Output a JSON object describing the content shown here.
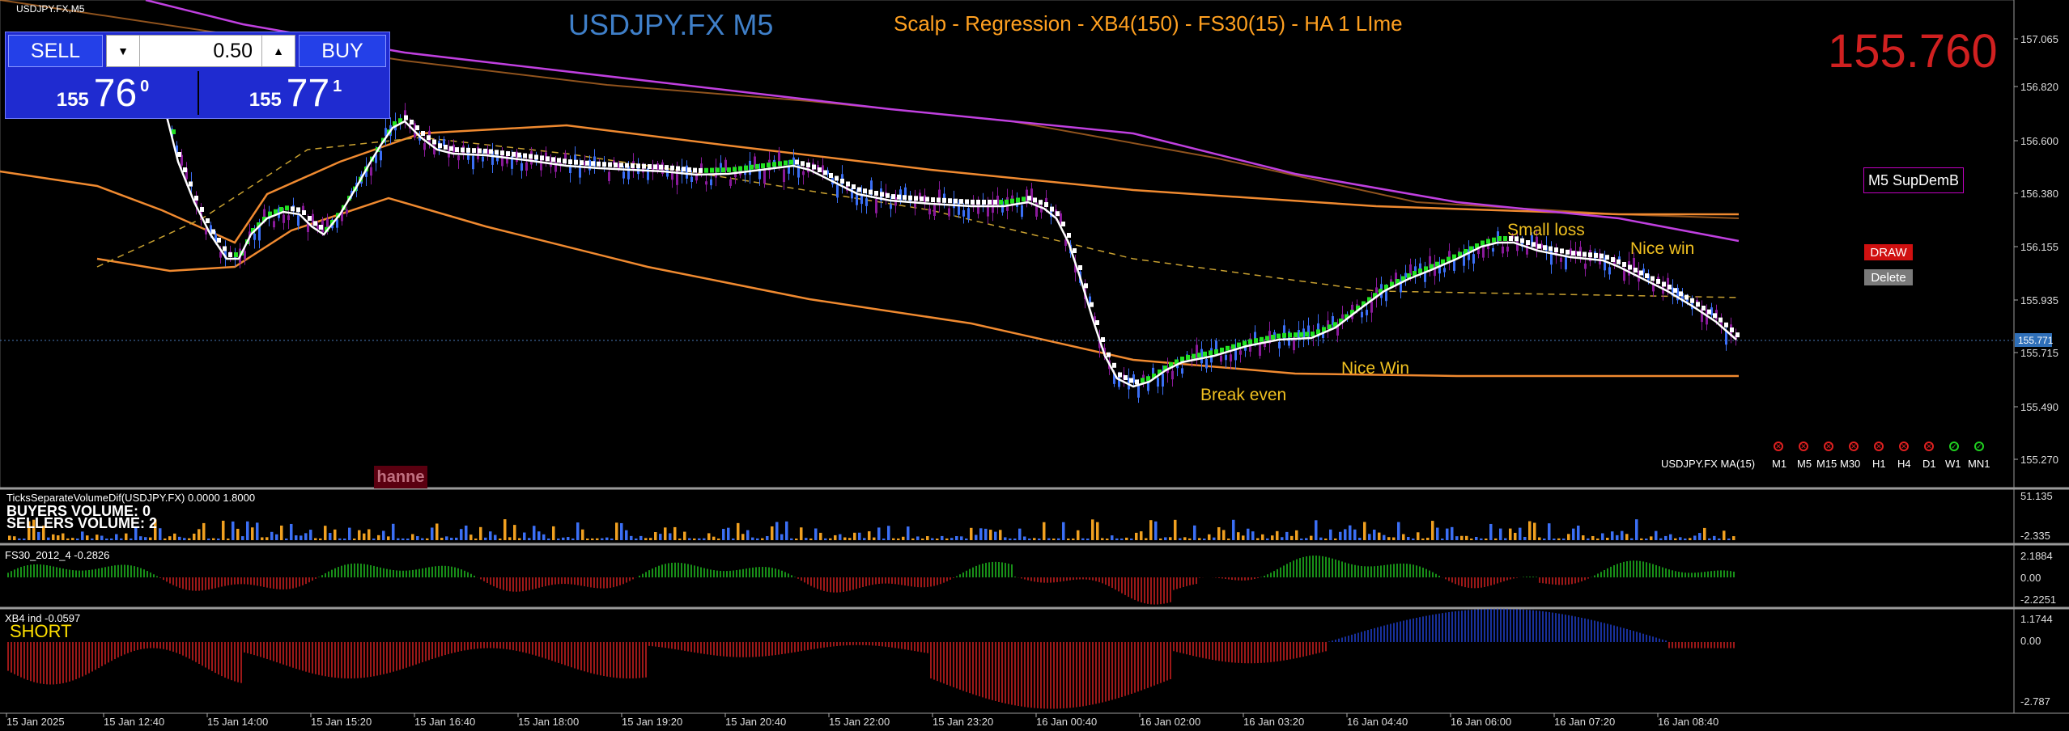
{
  "window": {
    "symbol_label": "USDJPY.FX,M5"
  },
  "header": {
    "title": "USDJPY.FX M5",
    "strategy": "Scalp - Regression - XB4(150) - FS30(15) - HA  1 LIme",
    "big_price": "155.760"
  },
  "trade_panel": {
    "sell_label": "SELL",
    "buy_label": "BUY",
    "lot_value": "0.50",
    "sell_quote": {
      "big": "155",
      "pips": "76",
      "frac": "0"
    },
    "buy_quote": {
      "big": "155",
      "pips": "77",
      "frac": "1"
    }
  },
  "right_controls": {
    "supdem_label": "M5 SupDemB",
    "draw_label": "DRAW",
    "delete_label": "Delete",
    "ma_label": "USDJPY.FX MA(15)",
    "timeframes": [
      "M1",
      "M5",
      "M15",
      "M30",
      "H1",
      "H4",
      "D1",
      "W1",
      "MN1"
    ]
  },
  "annotations": {
    "break_even": "Break even",
    "nice_win_low": "Nice Win",
    "small_loss": "Small loss",
    "nice_win_high": "Nice win"
  },
  "price_axis": {
    "ticks": [
      "157.065",
      "156.820",
      "156.600",
      "156.380",
      "156.155",
      "155.935",
      "155.715",
      "155.490",
      "155.270"
    ],
    "current_price": "155.771"
  },
  "time_axis": {
    "labels": [
      "15 Jan 2025",
      "15 Jan 12:40",
      "15 Jan 14:00",
      "15 Jan 15:20",
      "15 Jan 16:40",
      "15 Jan 18:00",
      "15 Jan 19:20",
      "15 Jan 20:40",
      "15 Jan 22:00",
      "15 Jan 23:20",
      "16 Jan 00:40",
      "16 Jan 02:00",
      "16 Jan 03:20",
      "16 Jan 04:40",
      "16 Jan 06:00",
      "16 Jan 07:20",
      "16 Jan 08:40"
    ]
  },
  "volume_panel": {
    "title": "TicksSeparateVolumeDif(USDJPY.FX) 0.0000 1.8000",
    "buyers": "BUYERS VOLUME: 0",
    "sellers": "SELLERS VOLUME: 2",
    "axis": [
      "51.135",
      "-2.335"
    ]
  },
  "fs30_panel": {
    "title": "FS30_2012_4 -0.2826",
    "axis": [
      "2.1884",
      "0.00",
      "-2.2251"
    ]
  },
  "xb4_panel": {
    "title": "XB4 ind -0.0597",
    "signal": "SHORT",
    "axis": [
      "1.1744",
      "0.00",
      "-2.787"
    ]
  },
  "watermark": "hanne",
  "colors": {
    "background": "#000000",
    "bull_candle": "#3b6ff5",
    "bear_candle": "#8a1a9a",
    "ha_up": "#22e022",
    "ha_down": "#ffffff",
    "regression_mid": "#ffffff",
    "channel_outer": "#f08a30",
    "channel_inner_dash": "#c8a030",
    "ma_purple": "#c040e0",
    "hist_up": "#20c020",
    "hist_down": "#d02020",
    "hist_blue": "#2040d0",
    "vol_buy": "#3b6ff5",
    "vol_sell": "#f0a020"
  }
}
